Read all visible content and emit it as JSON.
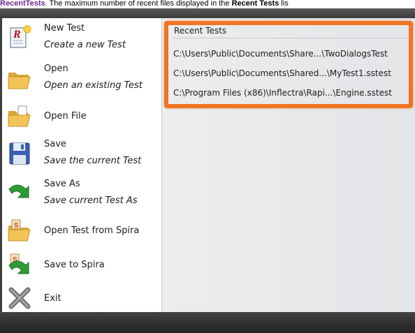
{
  "caption": {
    "keyword": "RecentTests",
    "text": ". The maximum number of recent files displayed in the ",
    "bold": "Recent Tests",
    "tail": " lis"
  },
  "menu": {
    "items": [
      {
        "name": "new-test",
        "label": "New Test",
        "sublabel": "Create a new Test",
        "icon": "new-test-icon"
      },
      {
        "name": "open",
        "label": "Open",
        "sublabel": "Open an existing Test",
        "icon": "open-folder-icon"
      },
      {
        "name": "open-file",
        "label": "Open File",
        "sublabel": "",
        "icon": "open-file-folder-icon"
      },
      {
        "name": "save",
        "label": "Save",
        "sublabel": "Save the current Test",
        "icon": "floppy-disk-icon"
      },
      {
        "name": "save-as",
        "label": "Save As",
        "sublabel": "Save current Test As",
        "icon": "save-as-arrow-icon"
      },
      {
        "name": "open-from-spira",
        "label": "Open Test from Spira",
        "sublabel": "",
        "icon": "spira-folder-icon"
      },
      {
        "name": "save-to-spira",
        "label": "Save to Spira",
        "sublabel": "",
        "icon": "spira-save-arrow-icon"
      },
      {
        "name": "exit",
        "label": "Exit",
        "sublabel": "",
        "icon": "exit-x-icon"
      }
    ]
  },
  "recent": {
    "title": "Recent Tests",
    "files": [
      "C:\\Users\\Public\\Documents\\Share...\\TwoDialogsTest",
      "C:\\Users\\Public\\Documents\\Shared...\\MyTest1.sstest",
      "C:\\Program Files (x86)\\Inflectra\\Rapi...\\Engine.sstest"
    ]
  },
  "colors": {
    "highlight": "#f07522",
    "frame": "#3f3f3f",
    "pane": "#e6e8ea",
    "caption_keyword": "#6b2c91"
  }
}
